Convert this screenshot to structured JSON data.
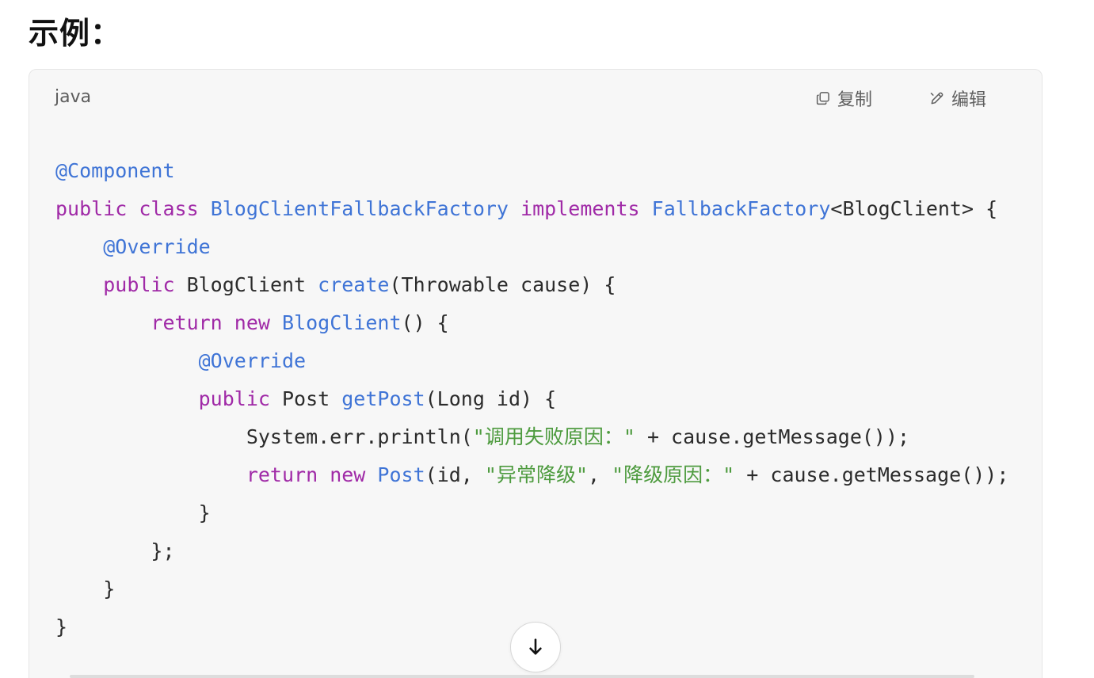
{
  "section": {
    "heading": "示例："
  },
  "code_block": {
    "language": "java",
    "copy_label": "复制",
    "edit_label": "编辑",
    "lines": [
      [
        {
          "t": "@Component",
          "c": "ann"
        }
      ],
      [
        {
          "t": "public",
          "c": "kw"
        },
        {
          "t": " ",
          "c": ""
        },
        {
          "t": "class",
          "c": "kw"
        },
        {
          "t": " ",
          "c": ""
        },
        {
          "t": "BlogClientFallbackFactory",
          "c": "cls"
        },
        {
          "t": " ",
          "c": ""
        },
        {
          "t": "implements",
          "c": "kw"
        },
        {
          "t": " ",
          "c": ""
        },
        {
          "t": "FallbackFactory",
          "c": "cls"
        },
        {
          "t": "<BlogClient> {",
          "c": ""
        }
      ],
      [
        {
          "t": "    ",
          "c": ""
        },
        {
          "t": "@Override",
          "c": "ann"
        }
      ],
      [
        {
          "t": "    ",
          "c": ""
        },
        {
          "t": "public",
          "c": "kw"
        },
        {
          "t": " BlogClient ",
          "c": ""
        },
        {
          "t": "create",
          "c": "fn"
        },
        {
          "t": "(Throwable cause) {",
          "c": ""
        }
      ],
      [
        {
          "t": "        ",
          "c": ""
        },
        {
          "t": "return",
          "c": "kw"
        },
        {
          "t": " ",
          "c": ""
        },
        {
          "t": "new",
          "c": "kw"
        },
        {
          "t": " ",
          "c": ""
        },
        {
          "t": "BlogClient",
          "c": "cls"
        },
        {
          "t": "() {",
          "c": ""
        }
      ],
      [
        {
          "t": "            ",
          "c": ""
        },
        {
          "t": "@Override",
          "c": "ann"
        }
      ],
      [
        {
          "t": "            ",
          "c": ""
        },
        {
          "t": "public",
          "c": "kw"
        },
        {
          "t": " Post ",
          "c": ""
        },
        {
          "t": "getPost",
          "c": "fn"
        },
        {
          "t": "(Long id) {",
          "c": ""
        }
      ],
      [
        {
          "t": "                System.err.println(",
          "c": ""
        },
        {
          "t": "\"调用失败原因：\"",
          "c": "str"
        },
        {
          "t": " + cause.getMessage());",
          "c": ""
        }
      ],
      [
        {
          "t": "                ",
          "c": ""
        },
        {
          "t": "return",
          "c": "kw"
        },
        {
          "t": " ",
          "c": ""
        },
        {
          "t": "new",
          "c": "kw"
        },
        {
          "t": " ",
          "c": ""
        },
        {
          "t": "Post",
          "c": "cls"
        },
        {
          "t": "(id, ",
          "c": ""
        },
        {
          "t": "\"异常降级\"",
          "c": "str"
        },
        {
          "t": ", ",
          "c": ""
        },
        {
          "t": "\"降级原因：\"",
          "c": "str"
        },
        {
          "t": " + cause.getMessage());",
          "c": ""
        }
      ],
      [
        {
          "t": "            }",
          "c": ""
        }
      ],
      [
        {
          "t": "        };",
          "c": ""
        }
      ],
      [
        {
          "t": "    }",
          "c": ""
        }
      ],
      [
        {
          "t": "}",
          "c": ""
        }
      ]
    ]
  },
  "icons": {
    "copy": "copy-icon",
    "edit": "edit-icon",
    "scroll_down": "arrow-down-icon"
  },
  "colors": {
    "annotation": "#3f74d6",
    "keyword": "#a02aa7",
    "string": "#4e9b3f",
    "text": "#2b2b2b",
    "code_background": "#f7f7f7"
  }
}
